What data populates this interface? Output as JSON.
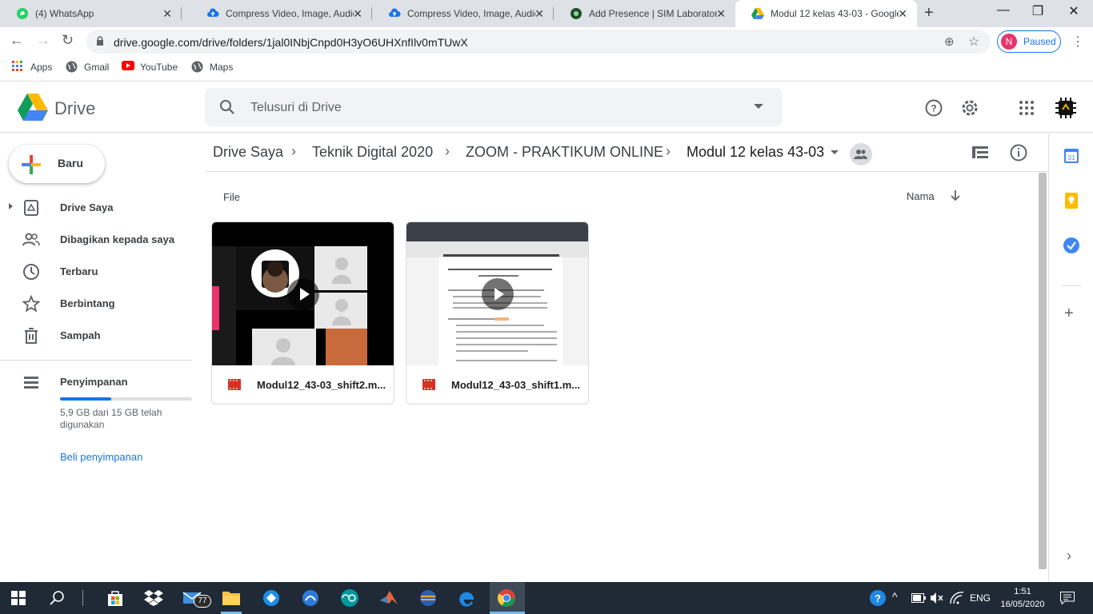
{
  "browser": {
    "tabs": [
      {
        "title": "(4) WhatsApp",
        "icon": "whatsapp-icon",
        "color": "#25d366"
      },
      {
        "title": "Compress Video, Image, Audio",
        "icon": "cloud-upload-icon",
        "color": "#1a73e8"
      },
      {
        "title": "Compress Video, Image, Audio",
        "icon": "cloud-upload-icon",
        "color": "#1a73e8"
      },
      {
        "title": "Add Presence | SIM Laboratorium",
        "icon": "sim-lab-icon",
        "color": "#1e5128"
      },
      {
        "title": "Modul 12 kelas 43-03 - Google",
        "icon": "google-drive-icon",
        "color": "#1a73e8"
      }
    ],
    "url": "drive.google.com/drive/folders/1jal0INbjCnpd0H3yO6UHXnfIlv0mTUwX",
    "profile_initial": "N",
    "profile_status": "Paused",
    "bookmarks": [
      {
        "label": "Apps",
        "icon": "apps-grid-icon"
      },
      {
        "label": "Gmail",
        "icon": "globe-icon"
      },
      {
        "label": "YouTube",
        "icon": "youtube-icon"
      },
      {
        "label": "Maps",
        "icon": "globe-icon"
      }
    ]
  },
  "drive": {
    "app_name": "Drive",
    "search_placeholder": "Telusuri di Drive",
    "new_label": "Baru",
    "nav": [
      {
        "label": "Drive Saya",
        "icon": "my-drive-icon"
      },
      {
        "label": "Dibagikan kepada saya",
        "icon": "shared-people-icon"
      },
      {
        "label": "Terbaru",
        "icon": "clock-icon"
      },
      {
        "label": "Berbintang",
        "icon": "star-icon"
      },
      {
        "label": "Sampah",
        "icon": "trash-icon"
      }
    ],
    "storage": {
      "label": "Penyimpanan",
      "usage_text": "5,9 GB dari 15 GB telah digunakan",
      "used_fraction": 0.39,
      "buy_label": "Beli penyimpanan"
    },
    "breadcrumb": [
      "Drive Saya",
      "Teknik Digital 2020",
      "ZOOM - PRAKTIKUM ONLINE",
      "Modul 12 kelas 43-03"
    ],
    "section_label": "File",
    "sort_label": "Nama",
    "files": [
      {
        "name": "Modul12_43-03_shift2.m..."
      },
      {
        "name": "Modul12_43-03_shift1.m..."
      }
    ]
  },
  "taskbar": {
    "mail_badge": "77",
    "language": "ENG",
    "time": "1:51",
    "date": "16/05/2020"
  }
}
